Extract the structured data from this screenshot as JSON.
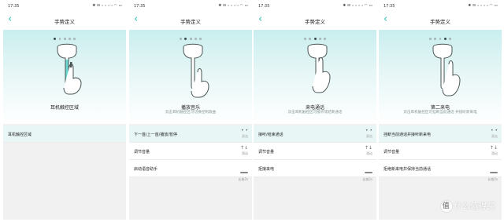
{
  "accent_color": "#32c4ba",
  "panels": [
    {
      "status_time": "17:35",
      "status_icons": "✱ ⊟ ᵢₗ ᵢₗ ᵢₗ ᵢₗ ◠ ▭",
      "back_icon": "chevron-left-icon",
      "title": "手势定义",
      "dots_active": 0,
      "caption": "耳机触控区域",
      "subcaption": "",
      "rows": [
        {
          "label": "耳机触控区域",
          "highlighted": true,
          "action_icon": "",
          "action_text": ""
        }
      ]
    },
    {
      "status_time": "17:35",
      "status_icons": "✱ ⊟ ᵢₗ ᵢₗ ᵢₗ ᵢₗ ◠ ▭",
      "back_icon": "chevron-left-icon",
      "title": "手势定义",
      "dots_active": 1,
      "caption": "播放音乐",
      "subcaption": "双击耳机触控区可切换控制歌曲",
      "rows": [
        {
          "label": "下一首/上一首/播放/暂停",
          "highlighted": true,
          "action_icon": "double-tap-icon",
          "action_glyph": "• •",
          "action_text": "双击"
        },
        {
          "label": "调节音量",
          "highlighted": false,
          "action_icon": "swipe-icon",
          "action_glyph": "↑↓",
          "action_text": "滑动"
        },
        {
          "label": "启动语音助手",
          "highlighted": false,
          "action_icon": "long-press-icon",
          "action_glyph": "",
          "action_text": "长按2s"
        }
      ]
    },
    {
      "status_time": "17:35",
      "status_icons": "✱ ⊟ ᵢₗ ᵢₗ ᵢₗ ᵢₗ ◠ ▭",
      "back_icon": "chevron-left-icon",
      "title": "手势定义",
      "dots_active": 2,
      "caption": "来电通话",
      "subcaption": "双击耳机触控区可接听或结束通话",
      "rows": [
        {
          "label": "接听/结束通话",
          "highlighted": true,
          "action_icon": "double-tap-icon",
          "action_glyph": "• •",
          "action_text": "双击"
        },
        {
          "label": "调节音量",
          "highlighted": false,
          "action_icon": "swipe-icon",
          "action_glyph": "↑↓",
          "action_text": "滑动"
        },
        {
          "label": "拒接来电",
          "highlighted": false,
          "action_icon": "long-press-icon",
          "action_glyph": "",
          "action_text": "长按2s"
        }
      ]
    },
    {
      "status_time": "17:35",
      "status_icons": "✱ ⊟ ᵢₗ ᵢₗ ᵢₗ ᵢₗ ◠ ▭",
      "back_icon": "chevron-left-icon",
      "title": "手势定义",
      "dots_active": 3,
      "caption": "第二来电",
      "subcaption": "双击耳机触控区可挂断当前通话 并接听新来电",
      "rows": [
        {
          "label": "挂断当前通话并接听新来电",
          "highlighted": true,
          "action_icon": "double-tap-icon",
          "action_glyph": "• •",
          "action_text": "双击"
        },
        {
          "label": "调节音量",
          "highlighted": false,
          "action_icon": "swipe-icon",
          "action_glyph": "↑↓",
          "action_text": "滑动"
        },
        {
          "label": "拒绝新来电并保持当前通话",
          "highlighted": false,
          "action_icon": "long-press-icon",
          "action_glyph": "",
          "action_text": "长按2s"
        }
      ]
    }
  ],
  "watermark": {
    "text": "什么值得买",
    "logo": "值"
  }
}
